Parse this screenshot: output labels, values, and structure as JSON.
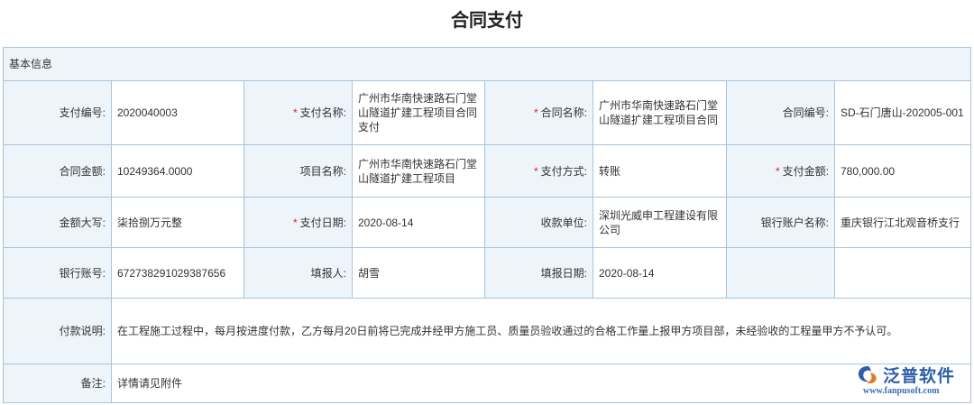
{
  "title": "合同支付",
  "section": "基本信息",
  "required_mark": "*",
  "fields": {
    "payment_no": {
      "label": "支付编号:",
      "value": "2020040003"
    },
    "payment_name": {
      "label": "支付名称:",
      "value": "广州市华南快速路石门堂山隧道扩建工程项目合同支付"
    },
    "contract_name": {
      "label": "合同名称:",
      "value": "广州市华南快速路石门堂山隧道扩建工程项目合同"
    },
    "contract_no": {
      "label": "合同编号:",
      "value": "SD-石门唐山-202005-001"
    },
    "contract_amount": {
      "label": "合同金额:",
      "value": "10249364.0000"
    },
    "project_name": {
      "label": "项目名称:",
      "value": "广州市华南快速路石门堂山隧道扩建工程项目"
    },
    "payment_method": {
      "label": "支付方式:",
      "value": "转账"
    },
    "payment_amount": {
      "label": "支付金额:",
      "value": "780,000.00"
    },
    "amount_upper": {
      "label": "金额大写:",
      "value": "柒拾捌万元整"
    },
    "payment_date": {
      "label": "支付日期:",
      "value": "2020-08-14"
    },
    "payee": {
      "label": "收款单位:",
      "value": "深圳光威申工程建设有限公司"
    },
    "bank_account_name": {
      "label": "银行账户名称:",
      "value": "重庆银行江北观音桥支行"
    },
    "bank_account_no": {
      "label": "银行账号:",
      "value": "672738291029387656"
    },
    "filler": {
      "label": "填报人:",
      "value": "胡雪"
    },
    "fill_date": {
      "label": "填报日期:",
      "value": "2020-08-14"
    },
    "payment_note": {
      "label": "付款说明:",
      "value": "在工程施工过程中，每月按进度付款，乙方每月20日前将已完成并经甲方施工员、质量员验收通过的合格工作量上报甲方项目部，未经验收的工程量甲方不予认可。"
    },
    "remark": {
      "label": "备注:",
      "value": "详情请见附件"
    }
  },
  "watermark": {
    "text": "泛普软件",
    "url": "www.fanpusoft.com",
    "color": "#2f5fa8"
  },
  "colors": {
    "label_bg": "#edf4fa",
    "border": "#a9c4dc",
    "required": "#e02020"
  }
}
